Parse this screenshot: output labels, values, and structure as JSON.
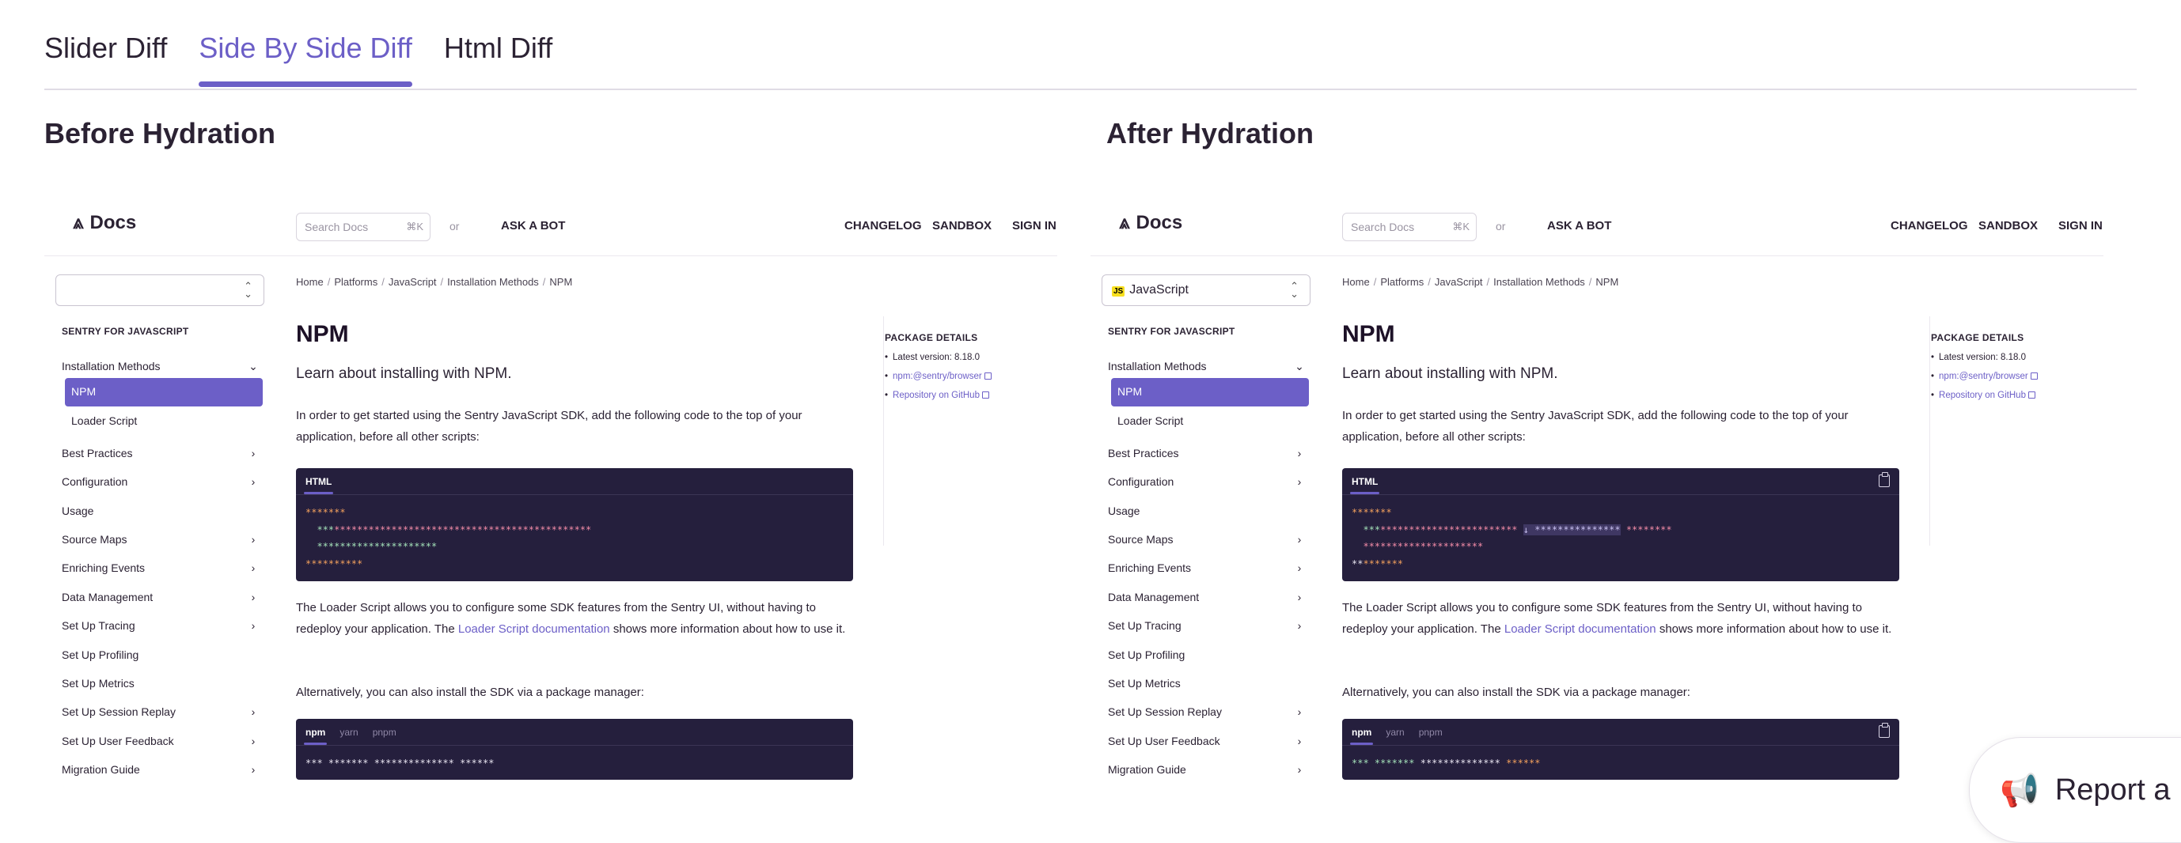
{
  "tabs": [
    "Slider Diff",
    "Side By Side Diff",
    "Html Diff"
  ],
  "active_tab": "Side By Side Diff",
  "panels": [
    {
      "title": "Before Hydration",
      "header": {
        "logo": "Docs",
        "search_placeholder": "Search Docs",
        "search_shortcut": "⌘K",
        "or": "or",
        "ask_bot": "ASK A BOT",
        "nav": [
          "CHANGELOG",
          "SANDBOX",
          "SIGN IN"
        ]
      },
      "platform_select": "",
      "sidebar": {
        "heading": "SENTRY FOR JAVASCRIPT",
        "items": [
          {
            "label": "Installation Methods",
            "chevron": "down"
          },
          {
            "label": "NPM",
            "sub": true,
            "active": true
          },
          {
            "label": "Loader Script",
            "sub": true
          },
          {
            "label": "Best Practices",
            "chevron": "right"
          },
          {
            "label": "Configuration",
            "chevron": "right"
          },
          {
            "label": "Usage"
          },
          {
            "label": "Source Maps",
            "chevron": "right"
          },
          {
            "label": "Enriching Events",
            "chevron": "right"
          },
          {
            "label": "Data Management",
            "chevron": "right"
          },
          {
            "label": "Set Up Tracing",
            "chevron": "right"
          },
          {
            "label": "Set Up Profiling"
          },
          {
            "label": "Set Up Metrics"
          },
          {
            "label": "Set Up Session Replay",
            "chevron": "right"
          },
          {
            "label": "Set Up User Feedback",
            "chevron": "right"
          },
          {
            "label": "Migration Guide",
            "chevron": "right"
          }
        ]
      },
      "breadcrumbs": [
        "Home",
        "Platforms",
        "JavaScript",
        "Installation Methods",
        "NPM"
      ],
      "page_title": "NPM",
      "lead": "Learn about installing with NPM.",
      "para1": "In order to get started using the Sentry JavaScript SDK, add the following code to the top of your application, before all other scripts:",
      "code1": {
        "tabs": [
          "HTML"
        ],
        "copy": false,
        "lines": [
          [
            {
              "t": "*******",
              "c": "orange"
            }
          ],
          [
            {
              "t": "  ",
              "c": "white"
            },
            {
              "t": "***",
              "c": "green"
            },
            {
              "t": "*********************************************",
              "c": "pink"
            }
          ],
          [
            {
              "t": "  ",
              "c": "white"
            },
            {
              "t": "*********************",
              "c": "green"
            }
          ],
          [
            {
              "t": "**********",
              "c": "orange"
            }
          ]
        ]
      },
      "para2_prefix": "The Loader Script allows you to configure some SDK features from the Sentry UI, without having to redeploy your application. The ",
      "para2_link": "Loader Script documentation",
      "para2_suffix": " shows more information about how to use it.",
      "para3": "Alternatively, you can also install the SDK via a package manager:",
      "code2": {
        "tabs": [
          "npm",
          "yarn",
          "pnpm"
        ],
        "copy": false,
        "lines": [
          [
            {
              "t": "*** ******* ************** ******",
              "c": "white"
            }
          ]
        ]
      },
      "toc": {
        "title": "PACKAGE DETAILS",
        "latest_version": "Latest version: 8.18.0",
        "links": [
          "npm:@sentry/browser",
          "Repository on GitHub"
        ]
      }
    },
    {
      "title": "After Hydration",
      "header": {
        "logo": "Docs",
        "search_placeholder": "Search Docs",
        "search_shortcut": "⌘K",
        "or": "or",
        "ask_bot": "ASK A BOT",
        "nav": [
          "CHANGELOG",
          "SANDBOX",
          "SIGN IN"
        ]
      },
      "platform_select": "JavaScript",
      "sidebar": {
        "heading": "SENTRY FOR JAVASCRIPT",
        "items": [
          {
            "label": "Installation Methods",
            "chevron": "down"
          },
          {
            "label": "NPM",
            "sub": true,
            "active": true
          },
          {
            "label": "Loader Script",
            "sub": true
          },
          {
            "label": "Best Practices",
            "chevron": "right"
          },
          {
            "label": "Configuration",
            "chevron": "right"
          },
          {
            "label": "Usage"
          },
          {
            "label": "Source Maps",
            "chevron": "right"
          },
          {
            "label": "Enriching Events",
            "chevron": "right"
          },
          {
            "label": "Data Management",
            "chevron": "right"
          },
          {
            "label": "Set Up Tracing",
            "chevron": "right"
          },
          {
            "label": "Set Up Profiling"
          },
          {
            "label": "Set Up Metrics"
          },
          {
            "label": "Set Up Session Replay",
            "chevron": "right"
          },
          {
            "label": "Set Up User Feedback",
            "chevron": "right"
          },
          {
            "label": "Migration Guide",
            "chevron": "right"
          }
        ]
      },
      "breadcrumbs": [
        "Home",
        "Platforms",
        "JavaScript",
        "Installation Methods",
        "NPM"
      ],
      "page_title": "NPM",
      "lead": "Learn about installing with NPM.",
      "para1": "In order to get started using the Sentry JavaScript SDK, add the following code to the top of your application, before all other scripts:",
      "code1": {
        "tabs": [
          "HTML"
        ],
        "copy": true,
        "lines": [
          [
            {
              "t": "*******",
              "c": "orange"
            }
          ],
          [
            {
              "t": "  ",
              "c": "white"
            },
            {
              "t": "***",
              "c": "green"
            },
            {
              "t": "************************ ",
              "c": "pink"
            },
            {
              "t": "↓ ***************",
              "c": "hl"
            },
            {
              "t": " ********",
              "c": "pink"
            }
          ],
          [
            {
              "t": "  ",
              "c": "white"
            },
            {
              "t": "*********************",
              "c": "pink"
            }
          ],
          [
            {
              "t": "**",
              "c": "white"
            },
            {
              "t": "*******",
              "c": "orange"
            }
          ]
        ]
      },
      "para2_prefix": "The Loader Script allows you to configure some SDK features from the Sentry UI, without having to redeploy your application. The ",
      "para2_link": "Loader Script documentation",
      "para2_suffix": " shows more information about how to use it.",
      "para3": "Alternatively, you can also install the SDK via a package manager:",
      "code2": {
        "tabs": [
          "npm",
          "yarn",
          "pnpm"
        ],
        "copy": true,
        "lines": [
          [
            {
              "t": "***",
              "c": "green"
            },
            {
              "t": " ",
              "c": "white"
            },
            {
              "t": "*******",
              "c": "green"
            },
            {
              "t": " ",
              "c": "white"
            },
            {
              "t": "**************",
              "c": "white"
            },
            {
              "t": " ",
              "c": "white"
            },
            {
              "t": "******",
              "c": "orange"
            }
          ]
        ]
      },
      "toc": {
        "title": "PACKAGE DETAILS",
        "latest_version": "Latest version: 8.18.0",
        "links": [
          "npm:@sentry/browser",
          "Repository on GitHub"
        ]
      }
    }
  ],
  "report_button": "Report a B"
}
